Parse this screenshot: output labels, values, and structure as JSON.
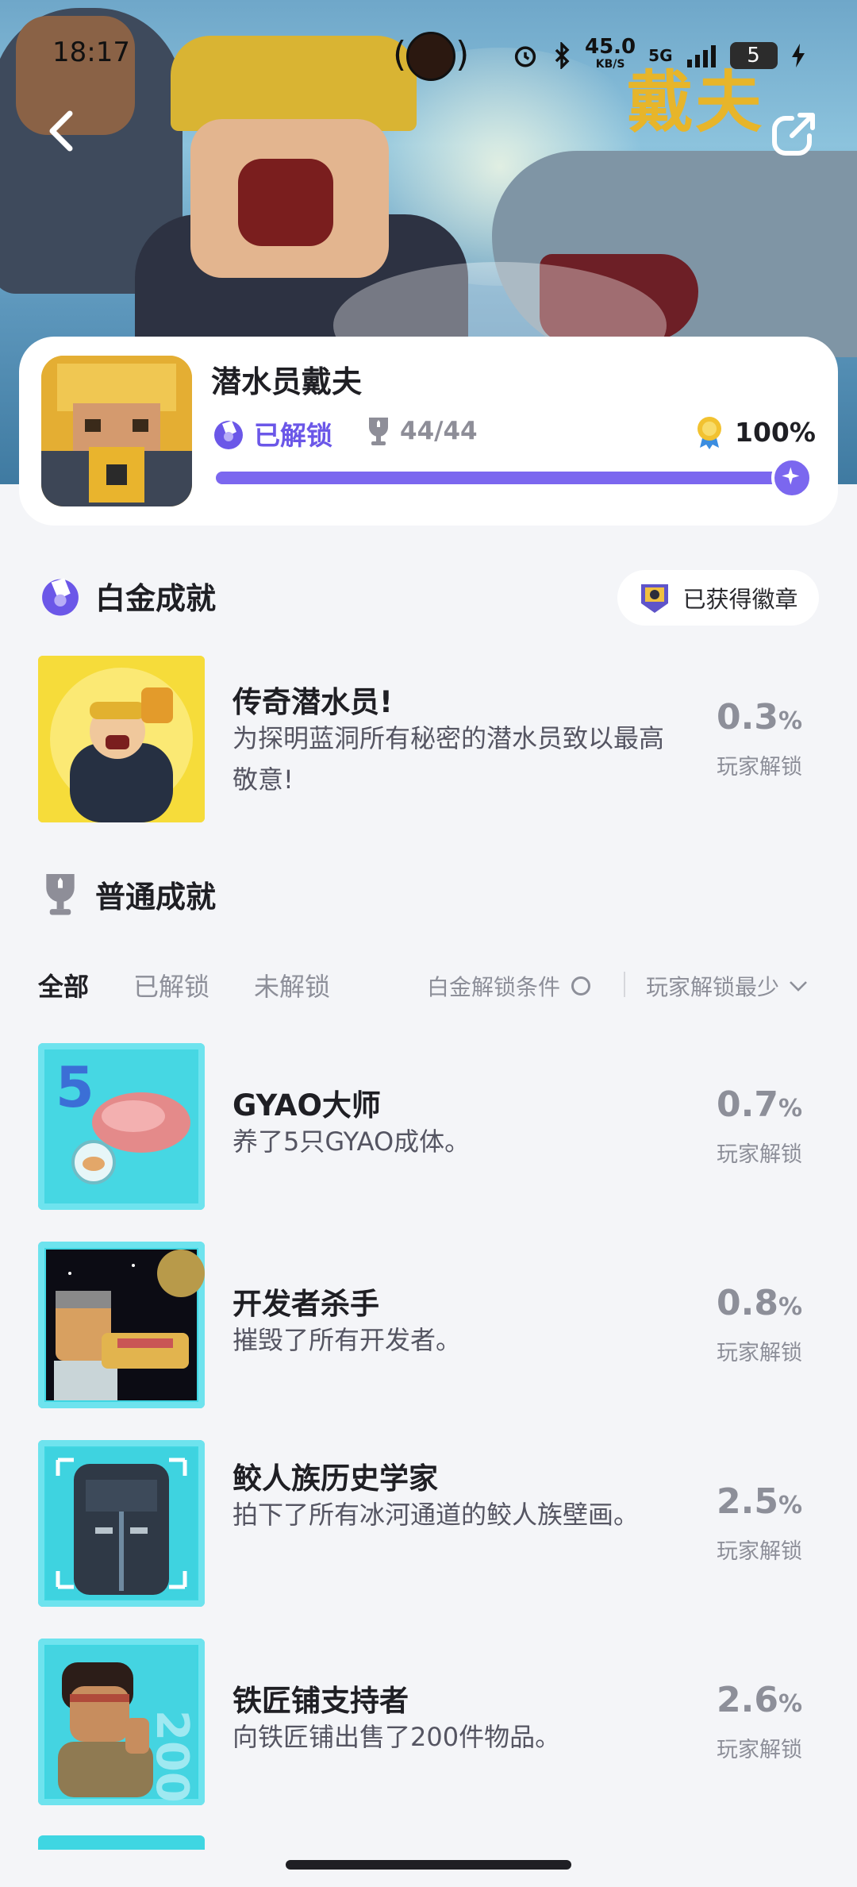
{
  "status_bar": {
    "time": "18:17",
    "speed_value": "45.0",
    "speed_unit": "KB/S",
    "network": "5G",
    "battery": "5"
  },
  "banner": {
    "title": "戴夫"
  },
  "game": {
    "name": "潜水员戴夫",
    "unlock_status": "已解锁",
    "trophy_count": "44/44",
    "completion_percent": "100%",
    "progress": 1.0
  },
  "platinum_section": {
    "title": "白金成就",
    "badge_label": "已获得徽章",
    "achievement": {
      "title": "传奇潜水员!",
      "description": "为探明蓝洞所有秘密的潜水员致以最高敬意!",
      "percent": "0.3",
      "percent_unit": "%",
      "percent_label": "玩家解锁"
    }
  },
  "normal_section": {
    "title": "普通成就",
    "tabs": [
      "全部",
      "已解锁",
      "未解锁"
    ],
    "condition_label": "白金解锁条件",
    "sort_label": "玩家解锁最少",
    "achievements": [
      {
        "title": "GYAO大师",
        "description": "养了5只GYAO成体。",
        "percent": "0.7",
        "percent_unit": "%",
        "percent_label": "玩家解锁"
      },
      {
        "title": "开发者杀手",
        "description": "摧毁了所有开发者。",
        "percent": "0.8",
        "percent_unit": "%",
        "percent_label": "玩家解锁"
      },
      {
        "title": "鲛人族历史学家",
        "description": "拍下了所有冰河通道的鲛人族壁画。",
        "percent": "2.5",
        "percent_unit": "%",
        "percent_label": "玩家解锁"
      },
      {
        "title": "铁匠铺支持者",
        "description": "向铁匠铺出售了200件物品。",
        "percent": "2.6",
        "percent_unit": "%",
        "percent_label": "玩家解锁"
      }
    ]
  },
  "colors": {
    "accent": "#7b67ef",
    "background": "#f4f5f8",
    "muted": "#8d8f99"
  }
}
